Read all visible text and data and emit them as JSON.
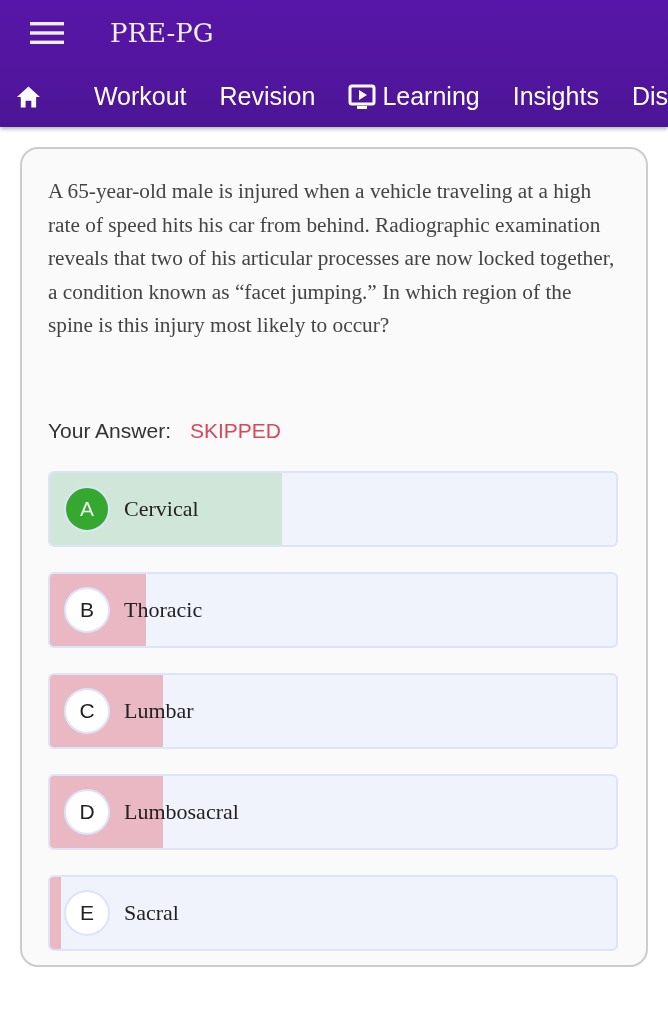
{
  "app_bar": {
    "title": "PRE-PG"
  },
  "tabs": [
    {
      "kind": "home"
    },
    {
      "label": "Workout"
    },
    {
      "label": "Revision"
    },
    {
      "label": "Learning",
      "kind": "video"
    },
    {
      "label": "Insights"
    },
    {
      "label": "Dis"
    }
  ],
  "question": "A 65-year-old male is injured when a vehicle traveling at a high rate of speed hits his car from behind. Radiographic examination reveals that two of his articular processes are now locked together, a condition known as “facet jumping.” In which region of the spine is this injury most likely to occur?",
  "answer": {
    "label": "Your Answer:",
    "value": "SKIPPED"
  },
  "options": [
    {
      "letter": "A",
      "text": "Cervical",
      "correct": true,
      "level": 0.41
    },
    {
      "letter": "B",
      "text": "Thoracic",
      "correct": false,
      "level": 0.17
    },
    {
      "letter": "C",
      "text": "Lumbar",
      "correct": false,
      "level": 0.2
    },
    {
      "letter": "D",
      "text": "Lumbosacral",
      "correct": false,
      "level": 0.2
    },
    {
      "letter": "E",
      "text": "Sacral",
      "correct": false,
      "level": 0.02
    }
  ]
}
